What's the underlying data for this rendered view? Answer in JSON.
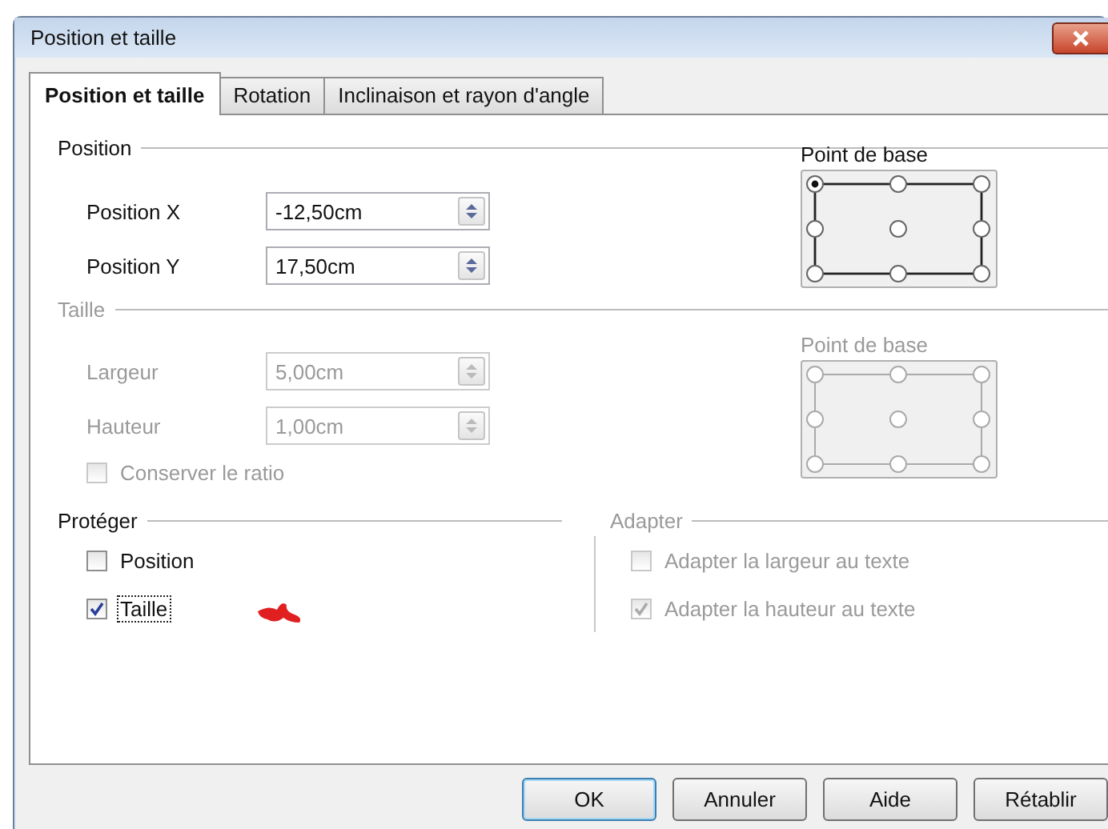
{
  "window": {
    "title": "Position et taille"
  },
  "tabs": [
    {
      "label": "Position et taille",
      "selected": true
    },
    {
      "label": "Rotation",
      "selected": false
    },
    {
      "label": "Inclinaison et rayon d'angle",
      "selected": false
    }
  ],
  "position": {
    "title": "Position",
    "disabled": false,
    "fields": [
      {
        "label": "Position X",
        "value": "-12,50cm"
      },
      {
        "label": "Position Y",
        "value": "17,50cm"
      }
    ],
    "base_point": {
      "label": "Point de base",
      "points": [
        {
          "selected": true
        },
        {
          "selected": false
        },
        {
          "selected": false
        },
        {
          "selected": false
        },
        {
          "selected": false
        },
        {
          "selected": false
        },
        {
          "selected": false
        },
        {
          "selected": false
        },
        {
          "selected": false
        }
      ]
    }
  },
  "size": {
    "title": "Taille",
    "disabled": true,
    "fields": [
      {
        "label": "Largeur",
        "value": "5,00cm"
      },
      {
        "label": "Hauteur",
        "value": "1,00cm"
      }
    ],
    "keep_ratio": {
      "label": "Conserver le ratio",
      "checked": false
    },
    "base_point": {
      "label": "Point de base",
      "points": [
        {
          "selected": false
        },
        {
          "selected": false
        },
        {
          "selected": false
        },
        {
          "selected": false
        },
        {
          "selected": false
        },
        {
          "selected": false
        },
        {
          "selected": false
        },
        {
          "selected": false
        },
        {
          "selected": false
        }
      ]
    }
  },
  "protect": {
    "title": "Protéger",
    "disabled": false,
    "options": [
      {
        "label": "Position",
        "checked": false,
        "focused": false
      },
      {
        "label": "Taille",
        "checked": true,
        "focused": true
      }
    ]
  },
  "fit": {
    "title": "Adapter",
    "disabled": true,
    "options": [
      {
        "label": "Adapter la largeur au texte",
        "checked": false,
        "focused": false
      },
      {
        "label": "Adapter la hauteur au texte",
        "checked": true,
        "focused": false
      }
    ]
  },
  "buttons": [
    {
      "label": "OK",
      "default": true
    },
    {
      "label": "Annuler",
      "default": false
    },
    {
      "label": "Aide",
      "default": false
    },
    {
      "label": "Rétablir",
      "default": false
    }
  ]
}
